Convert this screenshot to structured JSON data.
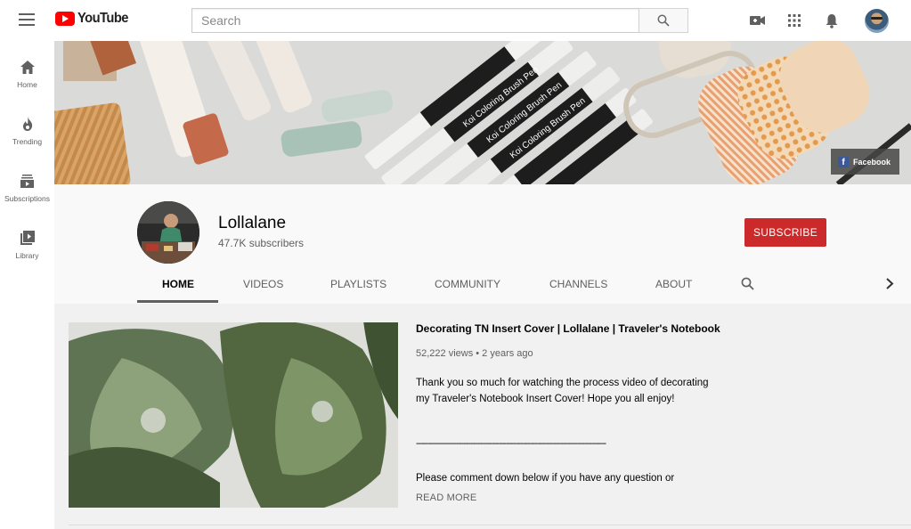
{
  "header": {
    "logo_text": "YouTube",
    "search": {
      "placeholder": "Search",
      "value": ""
    },
    "icons": [
      "upload-video-icon",
      "apps-grid-icon",
      "notifications-bell-icon",
      "account-avatar"
    ]
  },
  "sidebar": {
    "items": [
      {
        "label": "Home",
        "icon": "home-icon"
      },
      {
        "label": "Trending",
        "icon": "fire-icon"
      },
      {
        "label": "Subscriptions",
        "icon": "subscriptions-icon"
      },
      {
        "label": "Library",
        "icon": "library-icon"
      }
    ]
  },
  "banner": {
    "link_label": "Facebook",
    "pen_text": "Koi Coloring Brush Pen"
  },
  "channel": {
    "name": "Lollalane",
    "subscribers": "47.7K subscribers",
    "subscribe_label": "SUBSCRIBE",
    "tabs": [
      "HOME",
      "VIDEOS",
      "PLAYLISTS",
      "COMMUNITY",
      "CHANNELS",
      "ABOUT"
    ],
    "active_tab": "HOME"
  },
  "featured_video": {
    "title": "Decorating TN Insert Cover | Lollalane | Traveler's Notebook",
    "meta": "52,222 views • 2 years ago",
    "description": "Thank you so much for watching the process video of decorating my Traveler's Notebook Insert Cover! Hope you all enjoy!",
    "separator": "--------------------------------------------------------------------------------",
    "description_more": "Please comment down below if you have any question or",
    "read_more": "READ MORE"
  },
  "colors": {
    "brand_red": "#ff0000",
    "subscribe_red": "#cc2a2a",
    "text_secondary": "#606060",
    "page_bg": "#f1f1f1"
  }
}
